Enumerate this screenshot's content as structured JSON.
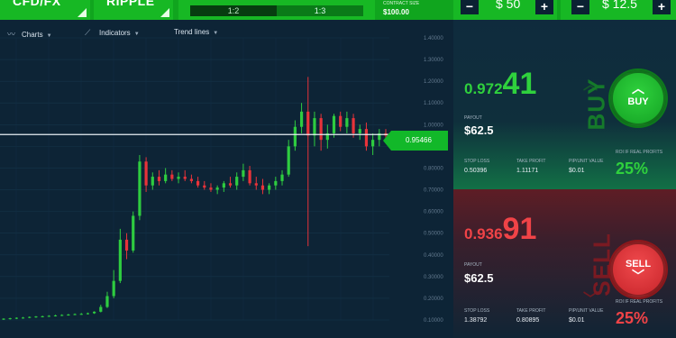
{
  "topbar": {
    "asset_class": "CFD/FX",
    "asset": "RIPPLE",
    "ratio_selected": "1:2",
    "ratio_other": "1:3",
    "contract_label": "CONTRACT SIZE",
    "contract_value": "$100.00",
    "amount": "$ 50",
    "amount2": "$ 12.5",
    "minus": "−",
    "plus": "+"
  },
  "toolbar": {
    "charts": "Charts",
    "indicators": "Indicators",
    "trendlines": "Trend lines"
  },
  "chart": {
    "current_price": "0.95466",
    "y_ticks": [
      "1.40000",
      "1.30000",
      "1.20000",
      "1.10000",
      "1.00000",
      "0.90000",
      "0.80000",
      "0.70000",
      "0.60000",
      "0.50000",
      "0.40000",
      "0.30000",
      "0.20000",
      "0.10000"
    ]
  },
  "chart_data": {
    "type": "candlestick",
    "ylim": [
      0.1,
      1.4
    ],
    "current_price": 0.95466,
    "candles": [
      {
        "o": 0.104,
        "h": 0.108,
        "l": 0.1,
        "c": 0.106
      },
      {
        "o": 0.106,
        "h": 0.11,
        "l": 0.102,
        "c": 0.108
      },
      {
        "o": 0.108,
        "h": 0.112,
        "l": 0.104,
        "c": 0.11
      },
      {
        "o": 0.11,
        "h": 0.114,
        "l": 0.106,
        "c": 0.111
      },
      {
        "o": 0.111,
        "h": 0.116,
        "l": 0.108,
        "c": 0.114
      },
      {
        "o": 0.114,
        "h": 0.118,
        "l": 0.11,
        "c": 0.116
      },
      {
        "o": 0.116,
        "h": 0.12,
        "l": 0.112,
        "c": 0.117
      },
      {
        "o": 0.117,
        "h": 0.122,
        "l": 0.114,
        "c": 0.119
      },
      {
        "o": 0.119,
        "h": 0.124,
        "l": 0.116,
        "c": 0.121
      },
      {
        "o": 0.121,
        "h": 0.126,
        "l": 0.118,
        "c": 0.123
      },
      {
        "o": 0.123,
        "h": 0.128,
        "l": 0.12,
        "c": 0.125
      },
      {
        "o": 0.125,
        "h": 0.13,
        "l": 0.122,
        "c": 0.127
      },
      {
        "o": 0.127,
        "h": 0.132,
        "l": 0.124,
        "c": 0.128
      },
      {
        "o": 0.128,
        "h": 0.134,
        "l": 0.125,
        "c": 0.131
      },
      {
        "o": 0.131,
        "h": 0.14,
        "l": 0.128,
        "c": 0.138
      },
      {
        "o": 0.138,
        "h": 0.17,
        "l": 0.135,
        "c": 0.16
      },
      {
        "o": 0.16,
        "h": 0.23,
        "l": 0.155,
        "c": 0.21
      },
      {
        "o": 0.21,
        "h": 0.33,
        "l": 0.2,
        "c": 0.28
      },
      {
        "o": 0.28,
        "h": 0.52,
        "l": 0.27,
        "c": 0.47
      },
      {
        "o": 0.47,
        "h": 0.5,
        "l": 0.38,
        "c": 0.42
      },
      {
        "o": 0.42,
        "h": 0.6,
        "l": 0.41,
        "c": 0.58
      },
      {
        "o": 0.58,
        "h": 0.86,
        "l": 0.56,
        "c": 0.83
      },
      {
        "o": 0.83,
        "h": 0.85,
        "l": 0.69,
        "c": 0.72
      },
      {
        "o": 0.72,
        "h": 0.78,
        "l": 0.7,
        "c": 0.76
      },
      {
        "o": 0.76,
        "h": 0.79,
        "l": 0.72,
        "c": 0.74
      },
      {
        "o": 0.74,
        "h": 0.8,
        "l": 0.73,
        "c": 0.77
      },
      {
        "o": 0.77,
        "h": 0.79,
        "l": 0.74,
        "c": 0.75
      },
      {
        "o": 0.75,
        "h": 0.78,
        "l": 0.73,
        "c": 0.76
      },
      {
        "o": 0.76,
        "h": 0.79,
        "l": 0.74,
        "c": 0.75
      },
      {
        "o": 0.75,
        "h": 0.77,
        "l": 0.73,
        "c": 0.74
      },
      {
        "o": 0.74,
        "h": 0.76,
        "l": 0.71,
        "c": 0.72
      },
      {
        "o": 0.72,
        "h": 0.74,
        "l": 0.7,
        "c": 0.71
      },
      {
        "o": 0.71,
        "h": 0.73,
        "l": 0.69,
        "c": 0.7
      },
      {
        "o": 0.7,
        "h": 0.72,
        "l": 0.68,
        "c": 0.71
      },
      {
        "o": 0.71,
        "h": 0.74,
        "l": 0.69,
        "c": 0.73
      },
      {
        "o": 0.73,
        "h": 0.76,
        "l": 0.71,
        "c": 0.72
      },
      {
        "o": 0.72,
        "h": 0.78,
        "l": 0.7,
        "c": 0.76
      },
      {
        "o": 0.76,
        "h": 0.82,
        "l": 0.74,
        "c": 0.79
      },
      {
        "o": 0.79,
        "h": 0.81,
        "l": 0.72,
        "c": 0.73
      },
      {
        "o": 0.73,
        "h": 0.76,
        "l": 0.7,
        "c": 0.72
      },
      {
        "o": 0.72,
        "h": 0.75,
        "l": 0.68,
        "c": 0.7
      },
      {
        "o": 0.7,
        "h": 0.73,
        "l": 0.68,
        "c": 0.72
      },
      {
        "o": 0.72,
        "h": 0.76,
        "l": 0.7,
        "c": 0.74
      },
      {
        "o": 0.74,
        "h": 0.79,
        "l": 0.72,
        "c": 0.77
      },
      {
        "o": 0.77,
        "h": 0.93,
        "l": 0.76,
        "c": 0.9
      },
      {
        "o": 0.9,
        "h": 1.02,
        "l": 0.88,
        "c": 0.99
      },
      {
        "o": 0.99,
        "h": 1.1,
        "l": 0.96,
        "c": 1.06
      },
      {
        "o": 1.06,
        "h": 1.22,
        "l": 0.44,
        "c": 0.95
      },
      {
        "o": 0.95,
        "h": 1.06,
        "l": 0.9,
        "c": 1.03
      },
      {
        "o": 1.03,
        "h": 1.05,
        "l": 0.88,
        "c": 0.93
      },
      {
        "o": 0.93,
        "h": 1.0,
        "l": 0.89,
        "c": 0.96
      },
      {
        "o": 0.96,
        "h": 1.05,
        "l": 0.94,
        "c": 1.04
      },
      {
        "o": 1.04,
        "h": 1.06,
        "l": 0.97,
        "c": 0.99
      },
      {
        "o": 0.99,
        "h": 1.06,
        "l": 0.96,
        "c": 1.03
      },
      {
        "o": 1.03,
        "h": 1.05,
        "l": 0.94,
        "c": 0.96
      },
      {
        "o": 0.96,
        "h": 1.0,
        "l": 0.93,
        "c": 0.98
      },
      {
        "o": 0.98,
        "h": 1.01,
        "l": 0.88,
        "c": 0.9
      },
      {
        "o": 0.9,
        "h": 0.96,
        "l": 0.86,
        "c": 0.93
      },
      {
        "o": 0.93,
        "h": 0.98,
        "l": 0.9,
        "c": 0.96
      },
      {
        "o": 0.96,
        "h": 0.98,
        "l": 0.92,
        "c": 0.95
      }
    ]
  },
  "buy": {
    "price_main": "0.972",
    "price_last": "41",
    "payout_label": "PAYOUT",
    "payout": "$62.5",
    "stop_label": "STOP LOSS",
    "stop": "0.50396",
    "take_label": "TAKE PROFIT",
    "take": "1.11171",
    "pip_label": "PIP/UNIT VALUE",
    "pip": "$0.01",
    "roi_label": "ROI IF REAL PROFITS",
    "roi": "25%",
    "button": "BUY",
    "word": "BUY"
  },
  "sell": {
    "price_main": "0.936",
    "price_last": "91",
    "payout_label": "PAYOUT",
    "payout": "$62.5",
    "stop_label": "STOP LOSS",
    "stop": "1.38792",
    "take_label": "TAKE PROFIT",
    "take": "0.80895",
    "pip_label": "PIP/UNIT VALUE",
    "pip": "$0.01",
    "roi_label": "ROI IF REAL PROFITS",
    "roi": "25%",
    "button": "SELL",
    "word": "SELL"
  },
  "colors": {
    "up": "#2ecc40",
    "down": "#e8333a",
    "accent": "#12b829"
  }
}
